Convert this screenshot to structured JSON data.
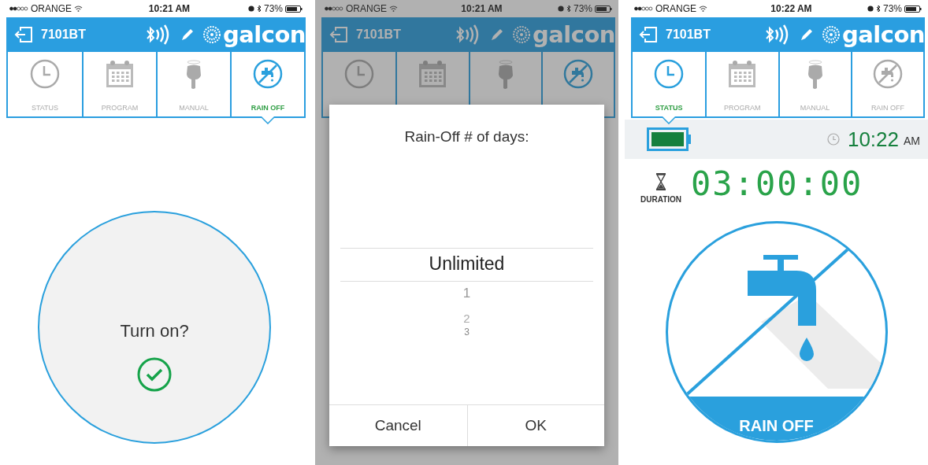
{
  "phones": [
    {
      "kind": "confirm",
      "status_bar": {
        "carrier": "ORANGE",
        "time": "10:21 AM",
        "battery": "73%"
      },
      "header": {
        "device": "7101BT",
        "brand": "galcon"
      },
      "tabs": [
        {
          "label": "STATUS",
          "selected": false
        },
        {
          "label": "PROGRAM",
          "selected": false
        },
        {
          "label": "MANUAL",
          "selected": false
        },
        {
          "label": "RAIN OFF",
          "selected": true
        }
      ],
      "prompt": "Turn on?"
    },
    {
      "kind": "picker",
      "status_bar": {
        "carrier": "ORANGE",
        "time": "10:21 AM",
        "battery": "73%"
      },
      "header": {
        "device": "7101BT",
        "brand": "galcon"
      },
      "tabs": [
        {
          "selected": false
        },
        {
          "selected": false
        },
        {
          "selected": false
        },
        {
          "selected": true
        }
      ],
      "dialog": {
        "title": "Rain-Off # of days:",
        "options": [
          {
            "label": "Unlimited",
            "selected": true
          },
          {
            "label": "1",
            "selected": false
          },
          {
            "label": "2",
            "selected": false
          },
          {
            "label": "3",
            "selected": false
          }
        ],
        "buttons": [
          "Cancel",
          "OK"
        ]
      }
    },
    {
      "kind": "status",
      "status_bar": {
        "carrier": "ORANGE",
        "time": "10:22 AM",
        "battery": "73%"
      },
      "header": {
        "device": "7101BT",
        "brand": "galcon"
      },
      "tabs": [
        {
          "label": "STATUS",
          "selected": true
        },
        {
          "label": "PROGRAM",
          "selected": false
        },
        {
          "label": "MANUAL",
          "selected": false
        },
        {
          "label": "RAIN OFF",
          "selected": false
        }
      ],
      "clock": {
        "time": "10:22",
        "period": "AM"
      },
      "duration": {
        "label": "DURATION",
        "value": "03:00:00"
      },
      "badge": "RAIN OFF"
    }
  ]
}
